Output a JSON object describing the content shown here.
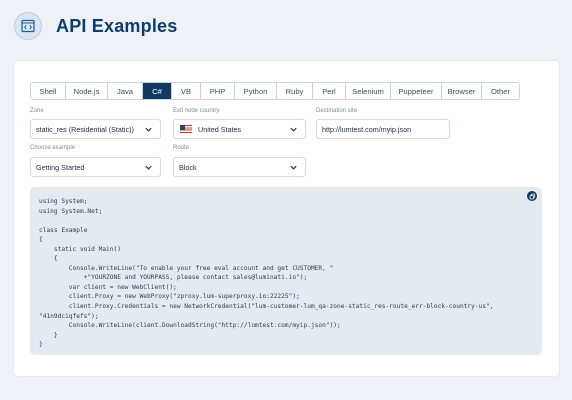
{
  "header": {
    "title": "API Examples",
    "logo_icon": "code-window-icon"
  },
  "tabs": [
    {
      "label": "Shell",
      "active": false
    },
    {
      "label": "Node.js",
      "active": false
    },
    {
      "label": "Java",
      "active": false
    },
    {
      "label": "C#",
      "active": true
    },
    {
      "label": "VB",
      "active": false
    },
    {
      "label": "PHP",
      "active": false
    },
    {
      "label": "Python",
      "active": false
    },
    {
      "label": "Ruby",
      "active": false
    },
    {
      "label": "Perl",
      "active": false
    },
    {
      "label": "Selenium",
      "active": false
    },
    {
      "label": "Puppeteer",
      "active": false
    },
    {
      "label": "Browser",
      "active": false
    },
    {
      "label": "Other",
      "active": false
    }
  ],
  "form": {
    "zone": {
      "label": "Zone",
      "value": "static_res (Residential (Static))"
    },
    "exit_node_country": {
      "label": "Exit node country",
      "value": "United States",
      "flag": "us-flag-icon"
    },
    "destination_site": {
      "label": "Destination site",
      "value": "http://lumtest.com/myip.json"
    },
    "choose_example": {
      "label": "Choose example",
      "value": "Getting Started"
    },
    "route": {
      "label": "Route",
      "value": "Block"
    }
  },
  "code": {
    "copy_icon": "copy-icon",
    "text": "using System;\nusing System.Net;\n\nclass Example\n{\n    static void Main()\n    {\n        Console.WriteLine(\"To enable your free eval account and get CUSTOMER, \"\n            +\"YOURZONE and YOURPASS, please contact sales@luminati.io\");\n        var client = new WebClient();\n        client.Proxy = new WebProxy(\"zproxy.lum-superproxy.io:22225\");\n        client.Proxy.Credentials = new NetworkCredential(\"lum-customer-lum_qa-zone-static_res-route_err-block-country-us\",\n\"41n9dciqfefs\");\n        Console.WriteLine(client.DownloadString(\"http://lumtest.com/myip.json\"));\n    }\n}"
  },
  "colors": {
    "accent": "#12395f",
    "title": "#0f3d6b",
    "page_bg": "#eef2f6",
    "code_bg": "#e3eaf0"
  }
}
